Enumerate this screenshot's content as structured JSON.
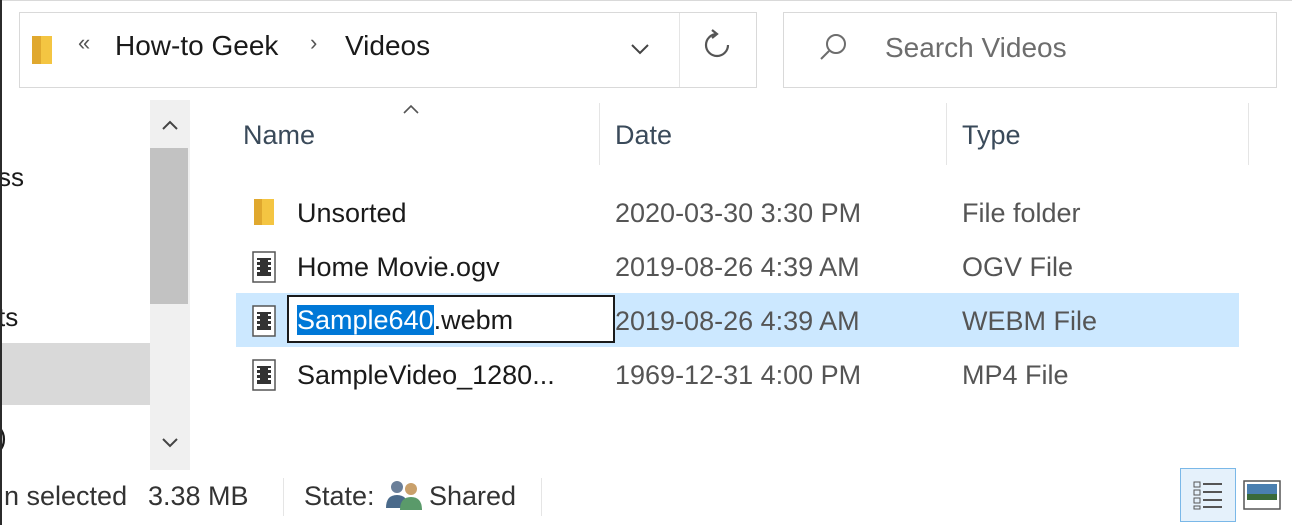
{
  "address_bar": {
    "overflow_chevron": "«",
    "breadcrumbs": [
      "How-to Geek",
      "Videos"
    ],
    "separator": "›",
    "dropdown_icon": "chevron-down-icon",
    "refresh_icon": "refresh-icon"
  },
  "search": {
    "placeholder": "Search Videos"
  },
  "nav_pane": {
    "fragments": [
      "ss",
      "ts",
      ")"
    ]
  },
  "columns": {
    "name": "Name",
    "date": "Date",
    "type": "Type"
  },
  "rows": [
    {
      "name": "Unsorted",
      "date": "2020-03-30 3:30 PM",
      "type": "File folder",
      "icon": "folder-icon"
    },
    {
      "name": "Home Movie.ogv",
      "date": "2019-08-26 4:39 AM",
      "type": "OGV File",
      "icon": "video-file-icon"
    },
    {
      "name_selected": "Sample640",
      "name_rest": ".webm",
      "date": "2019-08-26 4:39 AM",
      "type": "WEBM File",
      "icon": "video-file-icon",
      "selected": true,
      "renaming": true
    },
    {
      "name": "SampleVideo_1280...",
      "date": "1969-12-31 4:00 PM",
      "type": "MP4 File",
      "icon": "video-file-icon"
    }
  ],
  "status_bar": {
    "selected_text": "n selected",
    "size": "3.38 MB",
    "state_label": "State:",
    "state_value": "Shared"
  },
  "colors": {
    "selection": "#cce8ff",
    "rename_highlight": "#0078d7"
  }
}
